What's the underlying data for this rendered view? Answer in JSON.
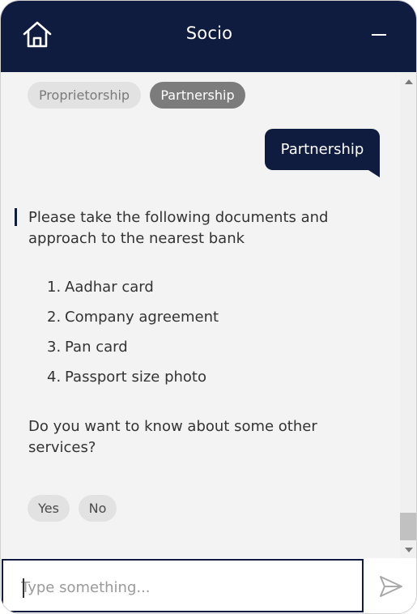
{
  "header": {
    "title": "Socio",
    "home_icon": "home-icon",
    "minimize_icon": "minimize-icon"
  },
  "chat": {
    "options_top": [
      {
        "label": "Proprietorship",
        "state": "inactive"
      },
      {
        "label": "Partnership",
        "state": "selected"
      }
    ],
    "user_message": "Partnership",
    "bot_message": {
      "intro_line1": "Please take the following documents and",
      "intro_line2": "approach to the nearest bank",
      "documents": [
        {
          "num": "1.",
          "label": "Aadhar card"
        },
        {
          "num": "2.",
          "label": "Company agreement"
        },
        {
          "num": "3.",
          "label": "Pan card"
        },
        {
          "num": "4.",
          "label": "Passport size photo"
        }
      ],
      "question_line1": "Do you want to know about some other",
      "question_line2": "services?"
    },
    "options_bottom": [
      {
        "label": "Yes"
      },
      {
        "label": "No"
      }
    ]
  },
  "input": {
    "placeholder": "Type something...",
    "value": "",
    "send_icon": "send-icon"
  },
  "colors": {
    "brand_navy": "#0f1c3f",
    "chat_bg": "#f3f3f3",
    "chip_selected": "#7c7c7c",
    "chip_default": "#e2e2e2"
  }
}
